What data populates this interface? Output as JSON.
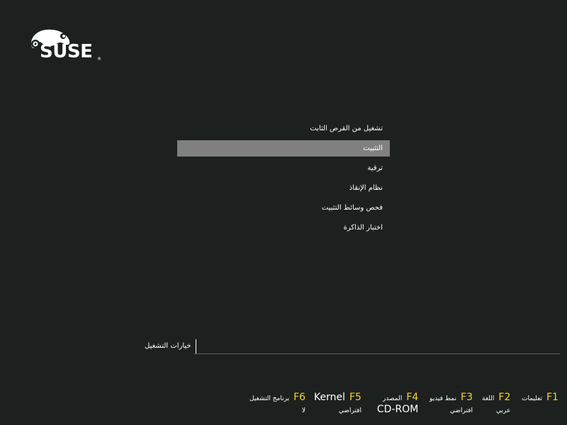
{
  "logo": {
    "wordmark": "SUSE",
    "registered": "®",
    "icon": "chameleon-icon"
  },
  "menu": {
    "items": [
      {
        "label": "تشغيل من القرص الثابت",
        "selected": false
      },
      {
        "label": "التثبيت",
        "selected": true
      },
      {
        "label": "ترقية",
        "selected": false
      },
      {
        "label": "نظام الإنقاذ",
        "selected": false
      },
      {
        "label": "فحص وسائط التثبيت",
        "selected": false
      },
      {
        "label": "اختبار الذاكرة",
        "selected": false
      }
    ]
  },
  "boot_options": {
    "label": "خيارات التشغيل",
    "value": ""
  },
  "function_keys": {
    "f1": {
      "key": "F1",
      "desc": "تعليمات",
      "value": ""
    },
    "f2": {
      "key": "F2",
      "desc": "اللغة",
      "value": "عربي"
    },
    "f3": {
      "key": "F3",
      "desc": "نمط فيديو",
      "value": "افتراضي"
    },
    "f4": {
      "key": "F4",
      "desc": "المصدر",
      "value": "CD-ROM"
    },
    "f5": {
      "key": "F5",
      "desc": "Kernel",
      "value": "افتراضي"
    },
    "f6": {
      "key": "F6",
      "desc": "برنامج التشغيل",
      "value": "لا"
    }
  },
  "colors": {
    "background": "#1c211f",
    "selection": "#7f807f",
    "fkey_accent": "#ffd02b"
  }
}
